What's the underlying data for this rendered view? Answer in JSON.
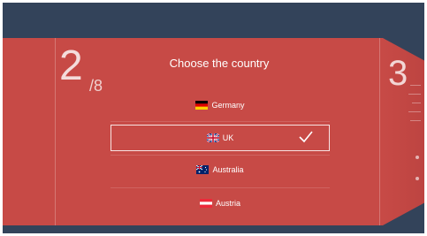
{
  "stepper": {
    "current": "2",
    "total": "/8",
    "next": "3"
  },
  "title": "Choose the country",
  "countries": [
    {
      "name": "Germany",
      "flag": "germany-flag-icon",
      "selected": false
    },
    {
      "name": "UK",
      "flag": "uk-flag-icon",
      "selected": true
    },
    {
      "name": "Australia",
      "flag": "australia-flag-icon",
      "selected": false
    },
    {
      "name": "Austria",
      "flag": "austria-flag-icon",
      "selected": false
    }
  ],
  "colors": {
    "background": "#33435a",
    "panel": "#c74a46",
    "text": "#ffffff"
  }
}
